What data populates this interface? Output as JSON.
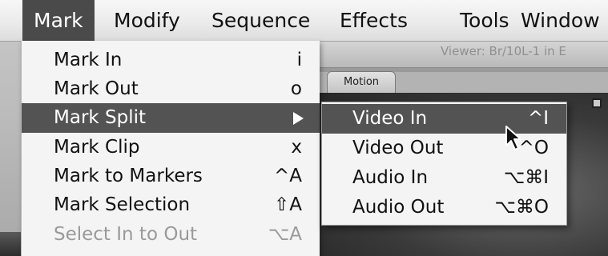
{
  "menubar": {
    "items": [
      {
        "label": "Mark"
      },
      {
        "label": "Modify"
      },
      {
        "label": "Sequence"
      },
      {
        "label": "Effects"
      },
      {
        "label": "Tools"
      },
      {
        "label": "Window"
      }
    ]
  },
  "viewer": {
    "title": "Viewer: Br/10L-1 in E",
    "tab_motion": "Motion"
  },
  "mark_menu": {
    "items": [
      {
        "label": "Mark In",
        "shortcut": "i"
      },
      {
        "label": "Mark Out",
        "shortcut": "o"
      },
      {
        "label": "Mark Split",
        "shortcut": ""
      },
      {
        "label": "Mark Clip",
        "shortcut": "x"
      },
      {
        "label": "Mark to Markers",
        "shortcut": "^A"
      },
      {
        "label": "Mark Selection",
        "shortcut": "⇧A"
      },
      {
        "label": "Select In to Out",
        "shortcut": "⌥A"
      }
    ]
  },
  "split_submenu": {
    "items": [
      {
        "label": "Video In",
        "shortcut": "^I"
      },
      {
        "label": "Video Out",
        "shortcut": "^O"
      },
      {
        "label": "Audio In",
        "shortcut": "⌥⌘I"
      },
      {
        "label": "Audio Out",
        "shortcut": "⌥⌘O"
      }
    ]
  },
  "colors": {
    "highlight": "#535353",
    "menu_background": "#f4f4f4",
    "disabled_text": "#9a9a9a"
  }
}
